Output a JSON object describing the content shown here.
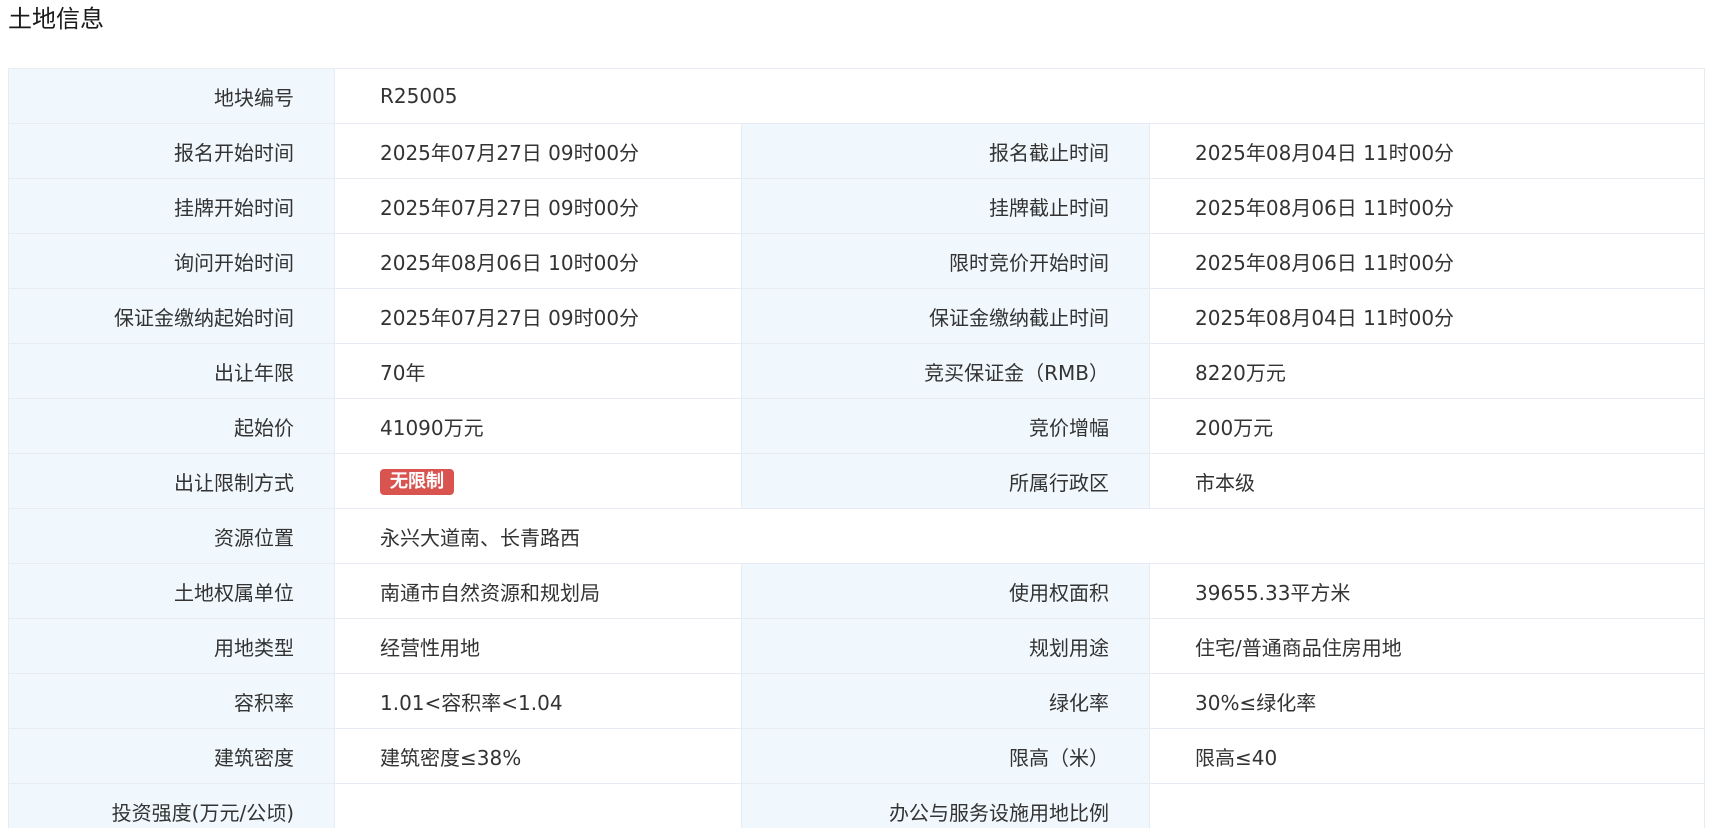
{
  "section": {
    "title": "土地信息"
  },
  "land": {
    "parcel_no": {
      "label": "地块编号",
      "value": "R25005"
    },
    "signup_start": {
      "label": "报名开始时间",
      "value": "2025年07月27日 09时00分"
    },
    "signup_end": {
      "label": "报名截止时间",
      "value": "2025年08月04日 11时00分"
    },
    "listing_start": {
      "label": "挂牌开始时间",
      "value": "2025年07月27日 09时00分"
    },
    "listing_end": {
      "label": "挂牌截止时间",
      "value": "2025年08月06日 11时00分"
    },
    "inquiry_start": {
      "label": "询问开始时间",
      "value": "2025年08月06日 10时00分"
    },
    "bidding_start": {
      "label": "限时竞价开始时间",
      "value": "2025年08月06日 11时00分"
    },
    "deposit_start": {
      "label": "保证金缴纳起始时间",
      "value": "2025年07月27日 09时00分"
    },
    "deposit_end": {
      "label": "保证金缴纳截止时间",
      "value": "2025年08月04日 11时00分"
    },
    "term": {
      "label": "出让年限",
      "value": "70年"
    },
    "deposit_amount": {
      "label": "竞买保证金（RMB）",
      "value": "8220万元"
    },
    "starting_price": {
      "label": "起始价",
      "value": "41090万元"
    },
    "bid_increment": {
      "label": "竞价增幅",
      "value": "200万元"
    },
    "restriction": {
      "label": "出让限制方式",
      "value": "无限制",
      "badge_color": "#d9534f"
    },
    "district": {
      "label": "所属行政区",
      "value": "市本级"
    },
    "location": {
      "label": "资源位置",
      "value": "永兴大道南、长青路西"
    },
    "owner": {
      "label": "土地权属单位",
      "value": "南通市自然资源和规划局"
    },
    "area": {
      "label": "使用权面积",
      "value": "39655.33平方米"
    },
    "land_type": {
      "label": "用地类型",
      "value": "经营性用地"
    },
    "planned_use": {
      "label": "规划用途",
      "value": "住宅/普通商品住房用地"
    },
    "plot_ratio": {
      "label": "容积率",
      "value": "1.01<容积率<1.04"
    },
    "greening_rate": {
      "label": "绿化率",
      "value": "30%≤绿化率"
    },
    "building_density": {
      "label": "建筑密度",
      "value": "建筑密度≤38%"
    },
    "height_limit": {
      "label": "限高（米）",
      "value": "限高≤40"
    },
    "investment_intensity": {
      "label": "投资强度(万元/公顷)",
      "value": ""
    },
    "office_ratio": {
      "label": "办公与服务设施用地比例",
      "value": ""
    }
  },
  "colors": {
    "label_bg": "#f1f8fd",
    "border": "#e6ecf1",
    "text": "#333333"
  }
}
